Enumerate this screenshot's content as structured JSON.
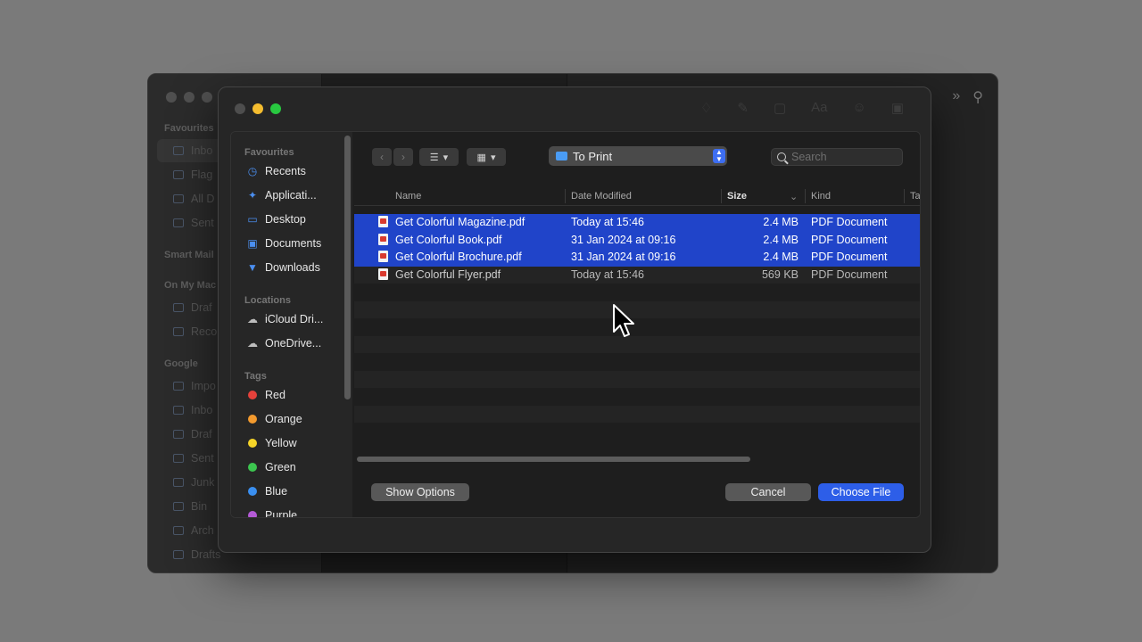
{
  "background_window": {
    "sections": [
      "Favourites",
      "Smart Mail",
      "On My Mac",
      "Google"
    ],
    "favourites": [
      "Inbo",
      "Flag",
      "All D",
      "Sent"
    ],
    "on_my_mac": [
      "Draf",
      "Reco"
    ],
    "google": [
      "Impo",
      "Inbo",
      "Draf",
      "Sent",
      "Junk",
      "Bin",
      "Arch",
      "Drafts"
    ]
  },
  "dialog": {
    "sidebar": {
      "favourites_title": "Favourites",
      "favourites": [
        {
          "label": "Recents",
          "icon": "clock-icon"
        },
        {
          "label": "Applicati...",
          "icon": "applications-icon"
        },
        {
          "label": "Desktop",
          "icon": "desktop-icon"
        },
        {
          "label": "Documents",
          "icon": "document-icon"
        },
        {
          "label": "Downloads",
          "icon": "download-icon"
        }
      ],
      "locations_title": "Locations",
      "locations": [
        {
          "label": "iCloud Dri...",
          "icon": "cloud-icon"
        },
        {
          "label": "OneDrive...",
          "icon": "onedrive-icon"
        }
      ],
      "tags_title": "Tags",
      "tags": [
        {
          "label": "Red",
          "color": "#e5413b"
        },
        {
          "label": "Orange",
          "color": "#f39a2e"
        },
        {
          "label": "Yellow",
          "color": "#f5d428"
        },
        {
          "label": "Green",
          "color": "#3cc64f"
        },
        {
          "label": "Blue",
          "color": "#3a8ff0"
        },
        {
          "label": "Purple",
          "color": "#b45ad6"
        }
      ]
    },
    "toolbar": {
      "location": "To Print",
      "search_placeholder": "Search"
    },
    "columns": {
      "name": "Name",
      "date": "Date Modified",
      "size": "Size",
      "kind": "Kind",
      "tags": "Ta"
    },
    "files": [
      {
        "name": "Get Colorful Magazine.pdf",
        "date": "Today at 15:46",
        "size": "2.4 MB",
        "kind": "PDF Document",
        "selected": true
      },
      {
        "name": "Get Colorful Book.pdf",
        "date": "31 Jan 2024 at 09:16",
        "size": "2.4 MB",
        "kind": "PDF Document",
        "selected": true
      },
      {
        "name": "Get Colorful Brochure.pdf",
        "date": "31 Jan 2024 at 09:16",
        "size": "2.4 MB",
        "kind": "PDF Document",
        "selected": true
      },
      {
        "name": "Get Colorful Flyer.pdf",
        "date": "Today at 15:46",
        "size": "569 KB",
        "kind": "PDF Document",
        "selected": false
      }
    ],
    "buttons": {
      "show_options": "Show Options",
      "cancel": "Cancel",
      "choose": "Choose File"
    }
  },
  "colors": {
    "accent": "#2d5ee8",
    "selection": "#2044c9"
  }
}
